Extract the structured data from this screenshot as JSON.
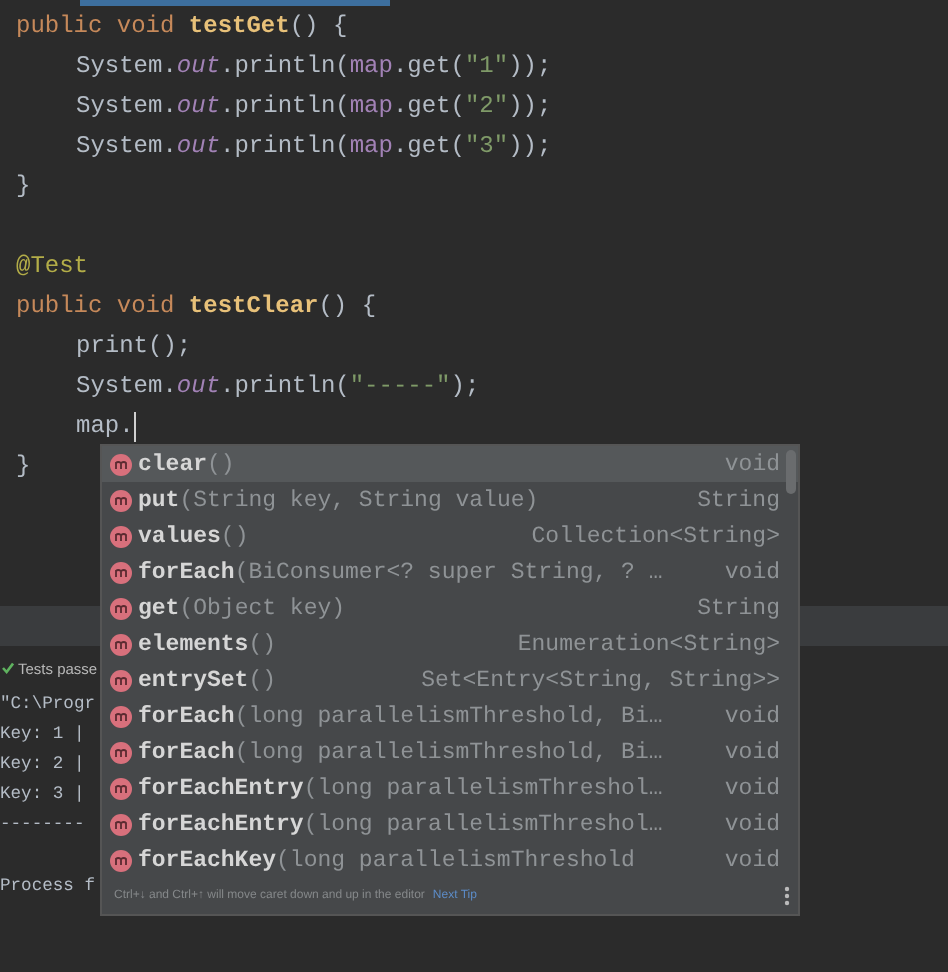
{
  "code": {
    "lines": [
      {
        "kind": "code",
        "indented": false,
        "caret": false,
        "tokens": [
          {
            "text": "public void ",
            "kind": "keyword"
          },
          {
            "text": "testGet",
            "kind": "method"
          },
          {
            "text": "() {",
            "kind": "plain"
          }
        ]
      },
      {
        "kind": "code",
        "indented": true,
        "caret": false,
        "tokens": [
          {
            "text": "System.",
            "kind": "plain"
          },
          {
            "text": "out",
            "kind": "field"
          },
          {
            "text": ".println(",
            "kind": "plain"
          },
          {
            "text": "map",
            "kind": "member"
          },
          {
            "text": ".get(",
            "kind": "plain"
          },
          {
            "text": "\"1\"",
            "kind": "string"
          },
          {
            "text": "));",
            "kind": "plain"
          }
        ]
      },
      {
        "kind": "code",
        "indented": true,
        "caret": false,
        "tokens": [
          {
            "text": "System.",
            "kind": "plain"
          },
          {
            "text": "out",
            "kind": "field"
          },
          {
            "text": ".println(",
            "kind": "plain"
          },
          {
            "text": "map",
            "kind": "member"
          },
          {
            "text": ".get(",
            "kind": "plain"
          },
          {
            "text": "\"2\"",
            "kind": "string"
          },
          {
            "text": "));",
            "kind": "plain"
          }
        ]
      },
      {
        "kind": "code",
        "indented": true,
        "caret": false,
        "tokens": [
          {
            "text": "System.",
            "kind": "plain"
          },
          {
            "text": "out",
            "kind": "field"
          },
          {
            "text": ".println(",
            "kind": "plain"
          },
          {
            "text": "map",
            "kind": "member"
          },
          {
            "text": ".get(",
            "kind": "plain"
          },
          {
            "text": "\"3\"",
            "kind": "string"
          },
          {
            "text": "));",
            "kind": "plain"
          }
        ]
      },
      {
        "kind": "code",
        "indented": false,
        "caret": false,
        "tokens": [
          {
            "text": "}",
            "kind": "plain"
          }
        ]
      },
      {
        "kind": "blank"
      },
      {
        "kind": "code",
        "indented": false,
        "caret": false,
        "tokens": [
          {
            "text": "@Test",
            "kind": "annotation"
          }
        ]
      },
      {
        "kind": "code",
        "indented": false,
        "caret": false,
        "tokens": [
          {
            "text": "public void ",
            "kind": "keyword"
          },
          {
            "text": "testClear",
            "kind": "method"
          },
          {
            "text": "() {",
            "kind": "plain"
          }
        ]
      },
      {
        "kind": "code",
        "indented": true,
        "caret": false,
        "tokens": [
          {
            "text": "print();",
            "kind": "plain"
          }
        ]
      },
      {
        "kind": "code",
        "indented": true,
        "caret": false,
        "tokens": [
          {
            "text": "System.",
            "kind": "plain"
          },
          {
            "text": "out",
            "kind": "field"
          },
          {
            "text": ".println(",
            "kind": "plain"
          },
          {
            "text": "\"-----\"",
            "kind": "string"
          },
          {
            "text": ");",
            "kind": "plain"
          }
        ]
      },
      {
        "kind": "code",
        "indented": true,
        "caret": true,
        "tokens": [
          {
            "text": "map.",
            "kind": "plain"
          }
        ]
      },
      {
        "kind": "code",
        "indented": false,
        "caret": false,
        "tokens": [
          {
            "text": "}",
            "kind": "plain"
          }
        ]
      }
    ]
  },
  "completion": {
    "items": [
      {
        "name": "clear",
        "params": "()",
        "type": "void",
        "selected": true
      },
      {
        "name": "put",
        "params": "(String key, String value)",
        "type": "String",
        "selected": false
      },
      {
        "name": "values",
        "params": "()",
        "type": "Collection<String>",
        "selected": false
      },
      {
        "name": "forEach",
        "params": "(BiConsumer<? super String, ? …",
        "type": "void",
        "selected": false
      },
      {
        "name": "get",
        "params": "(Object key)",
        "type": "String",
        "selected": false
      },
      {
        "name": "elements",
        "params": "()",
        "type": "Enumeration<String>",
        "selected": false
      },
      {
        "name": "entrySet",
        "params": "()",
        "type": "Set<Entry<String, String>>",
        "selected": false
      },
      {
        "name": "forEach",
        "params": "(long parallelismThreshold, Bi…",
        "type": "void",
        "selected": false
      },
      {
        "name": "forEach",
        "params": "(long parallelismThreshold, Bi…",
        "type": "void",
        "selected": false
      },
      {
        "name": "forEachEntry",
        "params": "(long parallelismThreshol…",
        "type": "void",
        "selected": false
      },
      {
        "name": "forEachEntry",
        "params": "(long parallelismThreshol…",
        "type": "void",
        "selected": false
      },
      {
        "name": "forEachKey",
        "params": "(long parallelismThreshold",
        "type": "void",
        "selected": false
      }
    ],
    "footer": {
      "hint": "Ctrl+↓ and Ctrl+↑ will move caret down and up in the editor",
      "link": "Next Tip"
    }
  },
  "run_panel": {
    "status": "Tests passe",
    "output": [
      {
        "text": "\"C:\\Progr",
        "spaced": false
      },
      {
        "text": "Key: 1 |",
        "spaced": false
      },
      {
        "text": "Key: 2 |",
        "spaced": false
      },
      {
        "text": "Key: 3 |",
        "spaced": false
      },
      {
        "text": "--------",
        "spaced": false
      },
      {
        "text": "Process f",
        "spaced": true
      }
    ]
  }
}
